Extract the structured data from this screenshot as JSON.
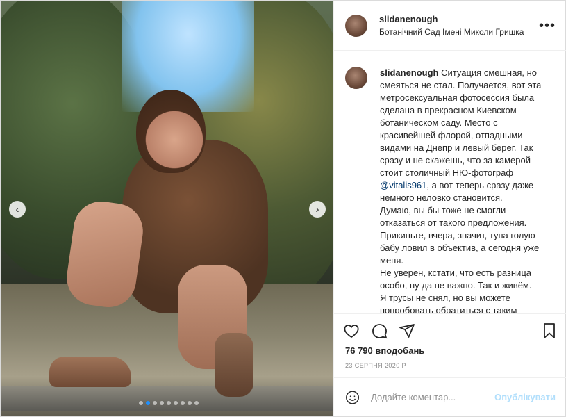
{
  "post": {
    "username": "slidanenough",
    "location": "Ботанічний Сад Імені Миколи Гришка",
    "more_label": "•••"
  },
  "media": {
    "nav_prev": "‹",
    "nav_next": "›",
    "slide_count": 9,
    "active_slide": 2
  },
  "caption": {
    "username": "slidanenough",
    "text_before_mention": "Ситуация смешная, но смеяться не стал. Получается, вот эта метросексуальная фотосессия была сделана в прекрасном Киевском ботаническом саду. Место с красивейшей флорой, отпадными видами на Днепр и левый берег. Так сразу и не скажешь, что за камерой стоит столичный НЮ-фотограф",
    "mention": "@vitalis961",
    "text_after_mention": ", а вот теперь сразу даже немного неловко становится.",
    "line2": "Думаю, вы бы тоже не смогли отказаться от такого предложения.",
    "line3": "Прикиньте, вчера, значит, тупа голую бабу ловил в объектив, а сегодня уже меня.",
    "line4": "Не уверен, кстати, что есть разница особо, ну да не важно. Так и живём.",
    "line5": "Я трусы не снял, но вы можете попробовать обратиться с таким"
  },
  "actions": {
    "like_icon": "heart-icon",
    "comment_icon": "comment-icon",
    "share_icon": "share-icon",
    "save_icon": "bookmark-icon"
  },
  "likes_text": "76 790 вподобань",
  "date_text": "23 СЕРПНЯ 2020 Р.",
  "comment": {
    "placeholder": "Додайте коментар...",
    "publish_label": "Опублікувати"
  },
  "colors": {
    "link": "#00376b",
    "publish_disabled": "#b2dffc",
    "active_dot": "#1e90ff"
  }
}
